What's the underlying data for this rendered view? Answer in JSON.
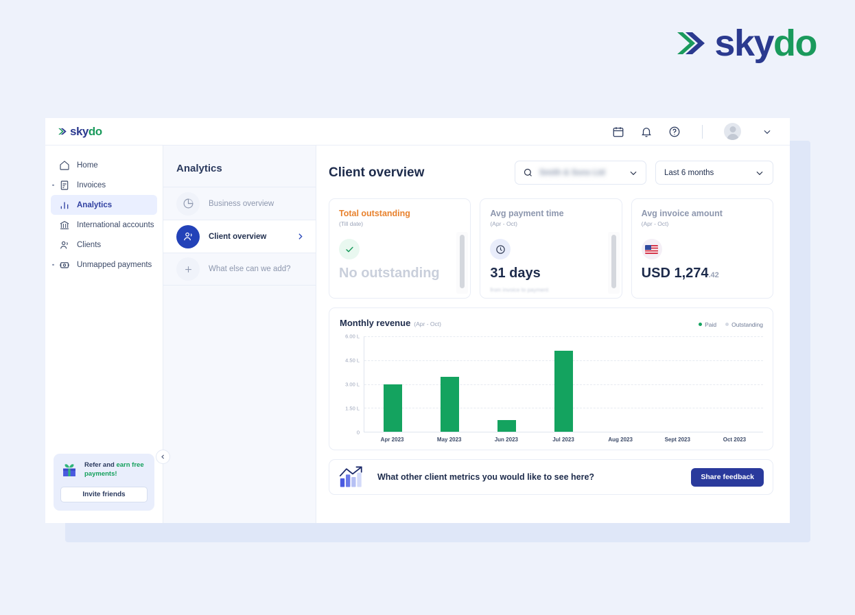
{
  "brand": {
    "name_part1": "sky",
    "name_part2": "do",
    "mark": "skydo-chevron-logo"
  },
  "topbar": {
    "icons": [
      {
        "name": "calendar-icon",
        "label": "Calendar"
      },
      {
        "name": "bell-icon",
        "label": "Notifications"
      },
      {
        "name": "help-icon",
        "label": "Help"
      }
    ],
    "avatar": "user-avatar",
    "chevron": "chevron-down-icon"
  },
  "sidebar": {
    "items": [
      {
        "label": "Home",
        "icon": "home-icon",
        "active": false,
        "has_dot": false
      },
      {
        "label": "Invoices",
        "icon": "invoice-icon",
        "active": false,
        "has_dot": true
      },
      {
        "label": "Analytics",
        "icon": "analytics-bars-icon",
        "active": true,
        "has_dot": false
      },
      {
        "label": "International accounts",
        "icon": "bank-icon",
        "active": false,
        "has_dot": false
      },
      {
        "label": "Clients",
        "icon": "clients-icon",
        "active": false,
        "has_dot": false
      },
      {
        "label": "Unmapped payments",
        "icon": "unmapped-payments-icon",
        "active": false,
        "has_dot": true
      }
    ],
    "refer": {
      "icon": "gift-icon",
      "text_normal": "Refer and ",
      "text_highlight": "earn free payments!",
      "button": "Invite friends"
    },
    "collapse": "chevron-left-icon"
  },
  "subnav": {
    "title": "Analytics",
    "items": [
      {
        "label": "Business overview",
        "icon": "pie-chart-icon",
        "active": false
      },
      {
        "label": "Client overview",
        "icon": "clients-icon",
        "active": true
      },
      {
        "label": "What else can we add?",
        "icon": "plus-icon",
        "active": false
      }
    ]
  },
  "main": {
    "title": "Client overview",
    "search": {
      "icon": "search-icon",
      "value": "Smith & Sons Ltd",
      "chevron": "chevron-down-icon"
    },
    "range": {
      "value": "Last 6 months",
      "chevron": "chevron-down-icon"
    },
    "kpis": [
      {
        "title": "Total outstanding",
        "subtitle": "(Till date)",
        "badge": "check-circle-icon",
        "value": "No outstanding",
        "note": "",
        "accent": "#e8822e"
      },
      {
        "title": "Avg payment time",
        "subtitle": "(Apr - Oct)",
        "badge": "clock-icon",
        "value": "31 days",
        "note": "from invoice to payment",
        "accent": "#8d97ae"
      },
      {
        "title": "Avg invoice amount",
        "subtitle": "(Apr - Oct)",
        "badge": "us-flag-icon",
        "value": "USD 1,274",
        "cents": ".42",
        "note": "",
        "accent": "#8d97ae"
      }
    ],
    "feedback": {
      "icon": "growth-chart-icon",
      "text": "What other client metrics you would like to see here?",
      "button": "Share feedback"
    }
  },
  "chart_data": {
    "type": "bar",
    "title": "Monthly revenue",
    "subtitle": "(Apr - Oct)",
    "xlabel": "",
    "ylabel": "",
    "categories": [
      "Apr 2023",
      "May 2023",
      "Jun 2023",
      "Jul 2023",
      "Aug 2023",
      "Sept 2023",
      "Oct 2023"
    ],
    "series": [
      {
        "name": "Paid",
        "color": "#14a35f",
        "values": [
          3.0,
          3.45,
          0.75,
          5.1,
          0,
          0,
          0
        ]
      },
      {
        "name": "Outstanding",
        "color": "#d5dae4",
        "values": [
          0,
          0,
          0,
          0,
          0,
          0,
          0
        ]
      }
    ],
    "ytick_labels": [
      "6.00 L",
      "4.50 L",
      "3.00 L",
      "1.50 L",
      "0"
    ],
    "ytick_values": [
      6.0,
      4.5,
      3.0,
      1.5,
      0
    ],
    "ylim": [
      0,
      6.0
    ],
    "unit": "L",
    "grid": true,
    "legend_position": "top-right",
    "legend": [
      {
        "label": "Paid",
        "color": "#14a35f"
      },
      {
        "label": "Outstanding",
        "color": "#d5dae4"
      }
    ]
  }
}
